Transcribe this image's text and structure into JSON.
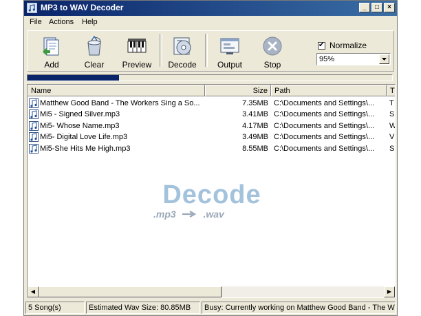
{
  "window": {
    "title": "MP3 to WAV Decoder",
    "min": "_",
    "max": "□",
    "close": "×"
  },
  "menu": [
    "File",
    "Actions",
    "Help"
  ],
  "toolbar": {
    "add": "Add",
    "clear": "Clear",
    "preview": "Preview",
    "decode": "Decode",
    "output": "Output",
    "stop": "Stop",
    "normalize_label": "Normalize",
    "normalize_checked": "✔",
    "level": "95%"
  },
  "progress": {
    "fraction": 0.25
  },
  "columns": [
    "Name",
    "Size",
    "Path",
    "T"
  ],
  "rows": [
    {
      "name": "Matthew Good Band - The Workers Sing a So...",
      "size": "7.35MB",
      "path": "C:\\Documents and Settings\\...",
      "type": "T"
    },
    {
      "name": "Mi5 - Signed Silver.mp3",
      "size": "3.41MB",
      "path": "C:\\Documents and Settings\\...",
      "type": "S"
    },
    {
      "name": "Mi5- Whose Name.mp3",
      "size": "4.17MB",
      "path": "C:\\Documents and Settings\\...",
      "type": "W"
    },
    {
      "name": "Mi5- Digital Love Life.mp3",
      "size": "3.49MB",
      "path": "C:\\Documents and Settings\\...",
      "type": "V"
    },
    {
      "name": "Mi5-She Hits Me High.mp3",
      "size": "8.55MB",
      "path": "C:\\Documents and Settings\\...",
      "type": "S"
    }
  ],
  "watermark": {
    "title": "Decode",
    "from": ".mp3",
    "to": ".wav"
  },
  "status": {
    "songs": "5 Song(s)",
    "size": "Estimated Wav Size: 80.85MB",
    "busy": "Busy: Currently working on Matthew Good Band - The W"
  },
  "colors": {
    "titlebar": "#0a246a",
    "progress": "#0a246a",
    "watermark": "#a3c2dc"
  }
}
